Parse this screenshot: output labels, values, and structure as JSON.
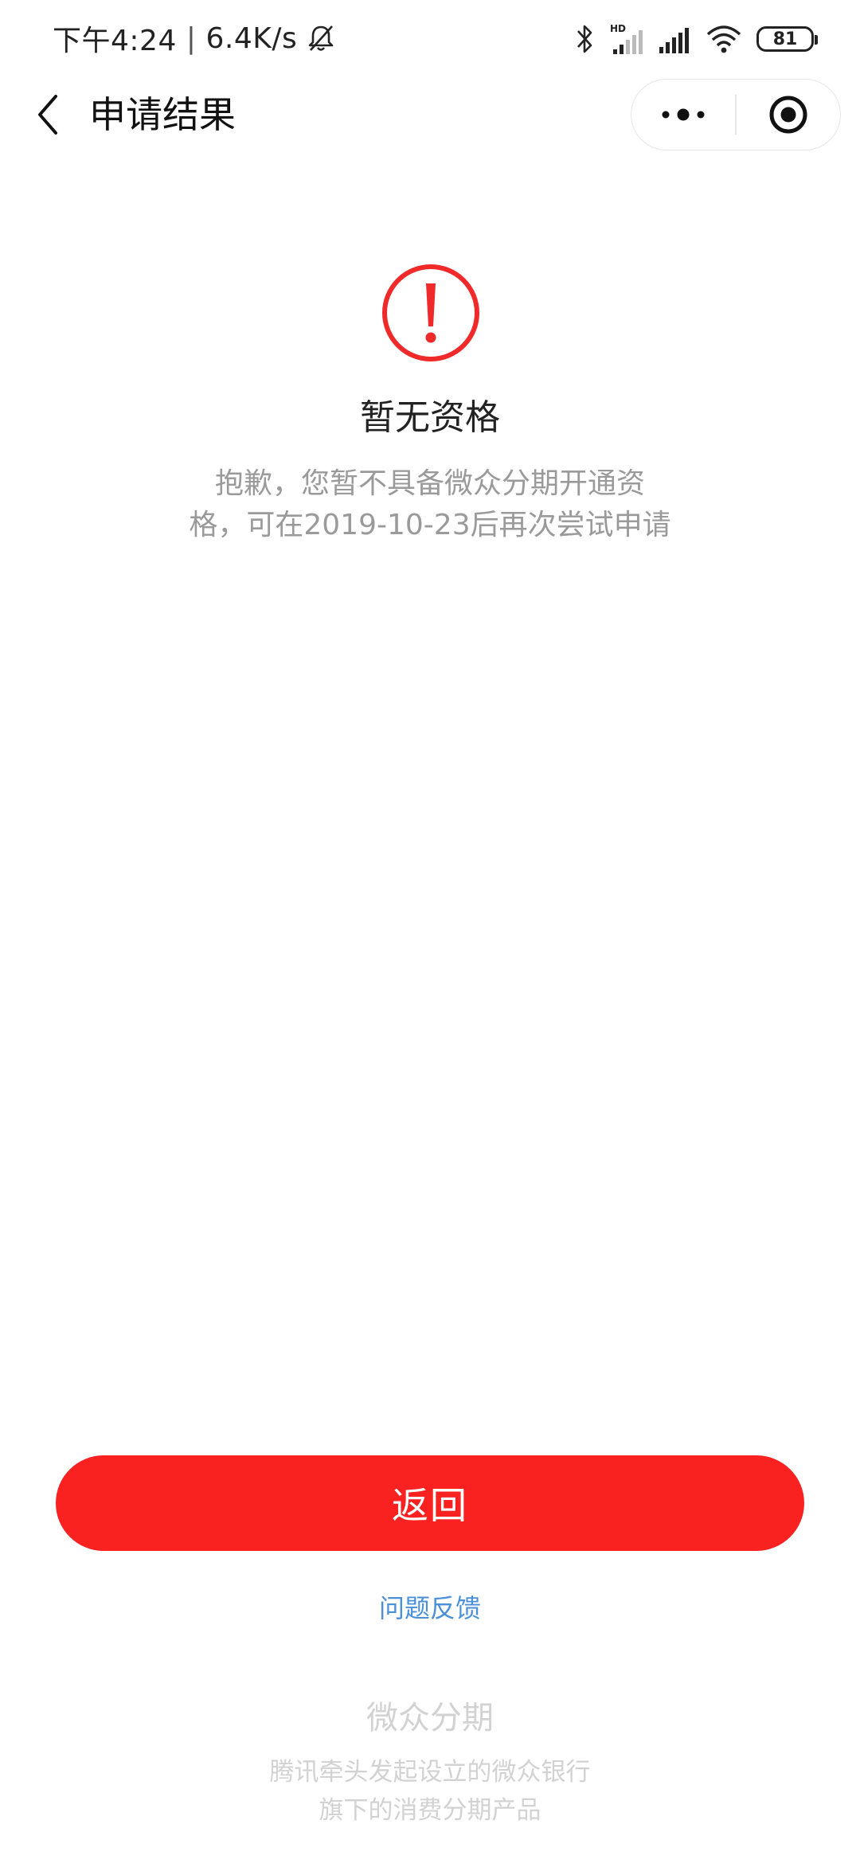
{
  "status_bar": {
    "time": "下午4:24",
    "separator": "|",
    "network_speed": "6.4K/s",
    "battery": "81",
    "icons": [
      "bell-off-icon",
      "bluetooth-icon",
      "hd-signal-icon",
      "signal-icon",
      "wifi-icon",
      "battery-icon"
    ]
  },
  "nav": {
    "title": "申请结果",
    "back_icon": "chevron-left-icon",
    "more_icon": "more-dots-icon",
    "close_icon": "target-close-icon"
  },
  "result": {
    "icon": "exclamation-circle-icon",
    "title": "暂无资格",
    "description_line1": "抱歉，您暂不具备微众分期开通资",
    "description_line2": "格，可在2019-10-23后再次尝试申请"
  },
  "actions": {
    "return_label": "返回",
    "feedback_label": "问题反馈"
  },
  "footer": {
    "brand": "微众分期",
    "desc_line1": "腾讯牵头发起设立的微众银行",
    "desc_line2": "旗下的消费分期产品"
  },
  "colors": {
    "accent_red": "#fa2121",
    "link_blue": "#4a90d9",
    "muted_gray": "#9a9a9a",
    "footer_gray": "#d2d2d2"
  }
}
